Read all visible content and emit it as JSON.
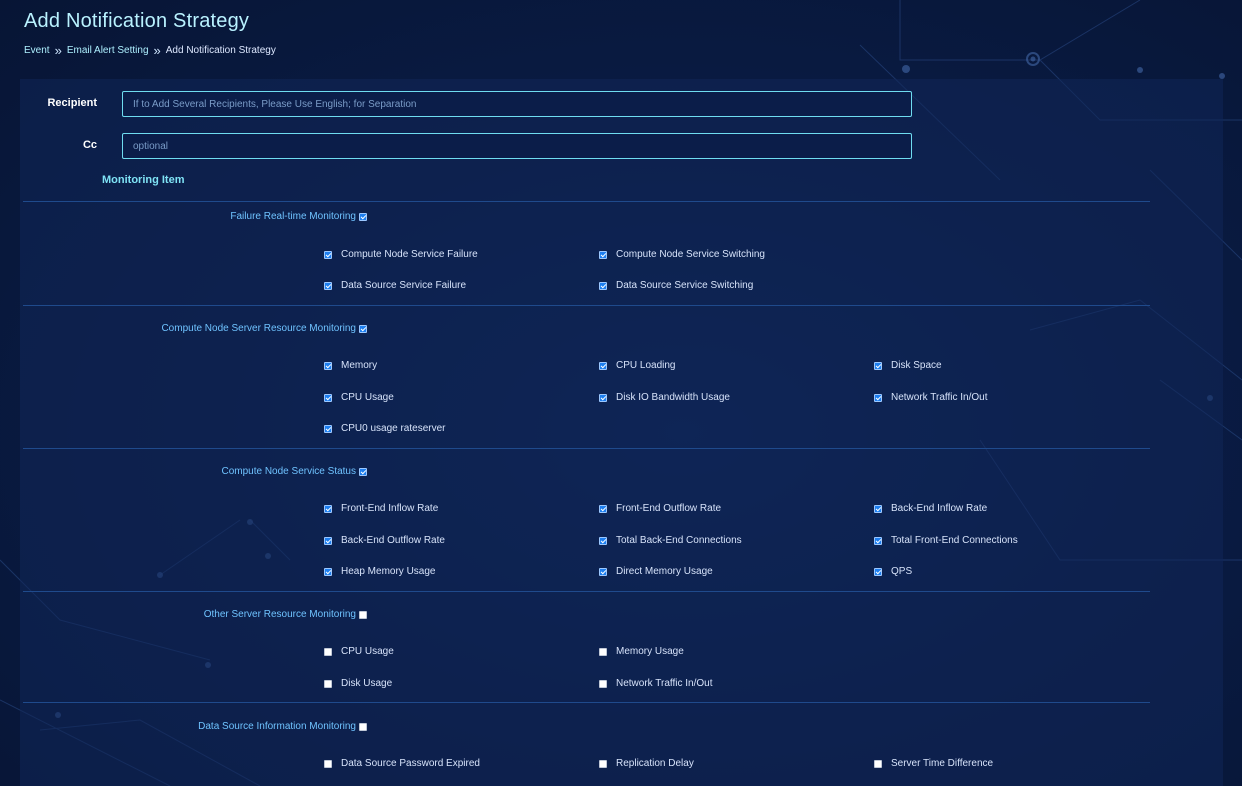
{
  "page": {
    "title": "Add Notification Strategy",
    "breadcrumb": [
      "Event",
      "Email Alert Setting",
      "Add Notification Strategy"
    ],
    "breadcrumb_separator": "»"
  },
  "form": {
    "recipient": {
      "label": "Recipient",
      "value": "",
      "placeholder": "If to Add Several Recipients, Please Use English; for Separation"
    },
    "cc": {
      "label": "Cc",
      "value": "",
      "placeholder": "optional"
    },
    "monitoring_heading": "Monitoring Item"
  },
  "groups": [
    {
      "title": "Failure Real-time Monitoring",
      "checked": true,
      "items": [
        {
          "label": "Compute Node Service Failure",
          "checked": true
        },
        {
          "label": "Compute Node Service Switching",
          "checked": true
        },
        {
          "label": "Data Source Service Failure",
          "checked": true
        },
        {
          "label": "Data Source Service Switching",
          "checked": true
        }
      ]
    },
    {
      "title": "Compute Node Server Resource Monitoring",
      "checked": true,
      "items": [
        {
          "label": "Memory",
          "checked": true
        },
        {
          "label": "CPU Loading",
          "checked": true
        },
        {
          "label": "Disk Space",
          "checked": true
        },
        {
          "label": "CPU Usage",
          "checked": true
        },
        {
          "label": "Disk IO Bandwidth Usage",
          "checked": true
        },
        {
          "label": "Network Traffic In/Out",
          "checked": true
        },
        {
          "label": "CPU0 usage rateserver",
          "checked": true
        }
      ]
    },
    {
      "title": "Compute Node Service Status",
      "checked": true,
      "items": [
        {
          "label": "Front-End Inflow Rate",
          "checked": true
        },
        {
          "label": "Front-End Outflow Rate",
          "checked": true
        },
        {
          "label": "Back-End Inflow Rate",
          "checked": true
        },
        {
          "label": "Back-End Outflow Rate",
          "checked": true
        },
        {
          "label": "Total Back-End Connections",
          "checked": true
        },
        {
          "label": "Total Front-End Connections",
          "checked": true
        },
        {
          "label": "Heap Memory Usage",
          "checked": true
        },
        {
          "label": "Direct Memory Usage",
          "checked": true
        },
        {
          "label": "QPS",
          "checked": true
        }
      ]
    },
    {
      "title": "Other Server Resource Monitoring",
      "checked": false,
      "items": [
        {
          "label": "CPU Usage",
          "checked": false
        },
        {
          "label": "Memory Usage",
          "checked": false
        },
        {
          "label": "Disk Usage",
          "checked": false
        },
        {
          "label": "Network Traffic In/Out",
          "checked": false
        }
      ]
    },
    {
      "title": "Data Source Information Monitoring",
      "checked": false,
      "items": [
        {
          "label": "Data Source Password Expired",
          "checked": false
        },
        {
          "label": "Replication Delay",
          "checked": false
        },
        {
          "label": "Server Time Difference",
          "checked": false
        }
      ]
    }
  ],
  "colors": {
    "background": "#0a1c45",
    "accent": "#6fdcf0",
    "group_title": "#6fc3ff",
    "checkbox_checked": "#1e7ff0"
  }
}
